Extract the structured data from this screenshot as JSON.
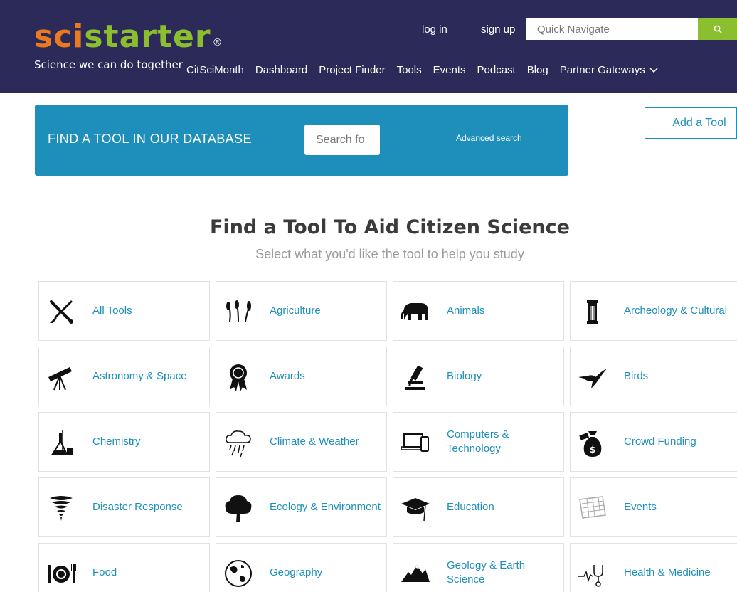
{
  "header": {
    "logo_sci": "sci",
    "logo_starter": "starter",
    "logo_reg": "®",
    "tagline": "Science we can do together",
    "login": "log in",
    "signup": "sign up",
    "quick_nav_placeholder": "Quick Navigate",
    "search_icon": "search-icon",
    "nav": [
      "CitSciMonth",
      "Dashboard",
      "Project Finder",
      "Tools",
      "Events",
      "Podcast",
      "Blog",
      "Partner Gateways"
    ]
  },
  "banner": {
    "title": "FIND A TOOL IN OUR DATABASE",
    "search_placeholder": "Search fo",
    "advanced_search": "Advanced search"
  },
  "add_tool": "Add a Tool",
  "heading": "Find a Tool To Aid Citizen Science",
  "subheading": "Select what you'd like the tool to help you study",
  "categories": [
    {
      "label": "All Tools",
      "icon": "tools-icon"
    },
    {
      "label": "Agriculture",
      "icon": "wheat-icon"
    },
    {
      "label": "Animals",
      "icon": "elephant-icon"
    },
    {
      "label": "Archeology & Cultural",
      "icon": "column-icon"
    },
    {
      "label": "Astronomy & Space",
      "icon": "telescope-icon"
    },
    {
      "label": "Awards",
      "icon": "award-ribbon-icon"
    },
    {
      "label": "Biology",
      "icon": "microscope-icon"
    },
    {
      "label": "Birds",
      "icon": "hummingbird-icon"
    },
    {
      "label": "Chemistry",
      "icon": "flask-icon"
    },
    {
      "label": "Climate & Weather",
      "icon": "rain-cloud-icon"
    },
    {
      "label": "Computers & Technology",
      "icon": "devices-icon"
    },
    {
      "label": "Crowd Funding",
      "icon": "money-bag-icon"
    },
    {
      "label": "Disaster Response",
      "icon": "tornado-icon"
    },
    {
      "label": "Ecology & Environment",
      "icon": "tree-icon"
    },
    {
      "label": "Education",
      "icon": "graduation-cap-icon"
    },
    {
      "label": "Events",
      "icon": "calendar-icon"
    },
    {
      "label": "Food",
      "icon": "plate-cutlery-icon"
    },
    {
      "label": "Geography",
      "icon": "globe-icon"
    },
    {
      "label": "Geology & Earth Science",
      "icon": "mountains-icon"
    },
    {
      "label": "Health & Medicine",
      "icon": "stethoscope-icon"
    }
  ],
  "colors": {
    "header_bg": "#2b2a58",
    "banner_bg": "#1d8fba",
    "accent_green": "#8cbf2f",
    "accent_orange": "#e97a1f",
    "link_blue": "#1d8fba"
  }
}
